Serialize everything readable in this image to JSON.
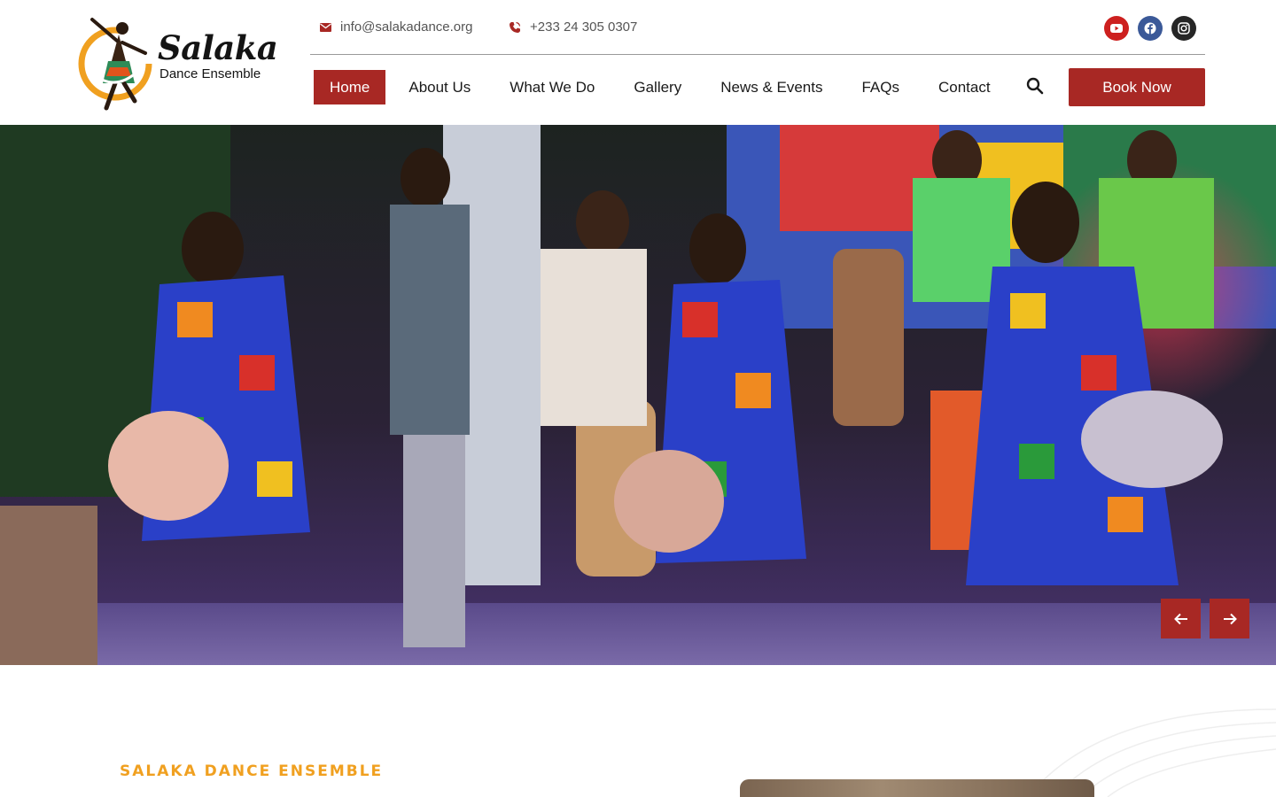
{
  "brand": {
    "title": "Salaka",
    "subtitle": "Dance Ensemble"
  },
  "contact": {
    "email": "info@salakadance.org",
    "phone": "+233 24 305 0307"
  },
  "socials": [
    {
      "name": "youtube-icon",
      "color": "#cd201f"
    },
    {
      "name": "facebook-icon",
      "color": "#3b5998"
    },
    {
      "name": "instagram-icon",
      "color": "#262626"
    }
  ],
  "nav": {
    "items": [
      {
        "label": "Home",
        "active": true
      },
      {
        "label": "About Us"
      },
      {
        "label": "What We Do"
      },
      {
        "label": "Gallery"
      },
      {
        "label": "News & Events"
      },
      {
        "label": "FAQs"
      },
      {
        "label": "Contact"
      }
    ],
    "search_icon": "search-icon",
    "cta_label": "Book Now"
  },
  "hero": {
    "slider_prev_icon": "arrow-left-icon",
    "slider_next_icon": "arrow-right-icon"
  },
  "about": {
    "kicker": "SALAKA DANCE ENSEMBLE"
  },
  "colors": {
    "brand_red": "#a82824",
    "accent_orange": "#f0a020"
  }
}
